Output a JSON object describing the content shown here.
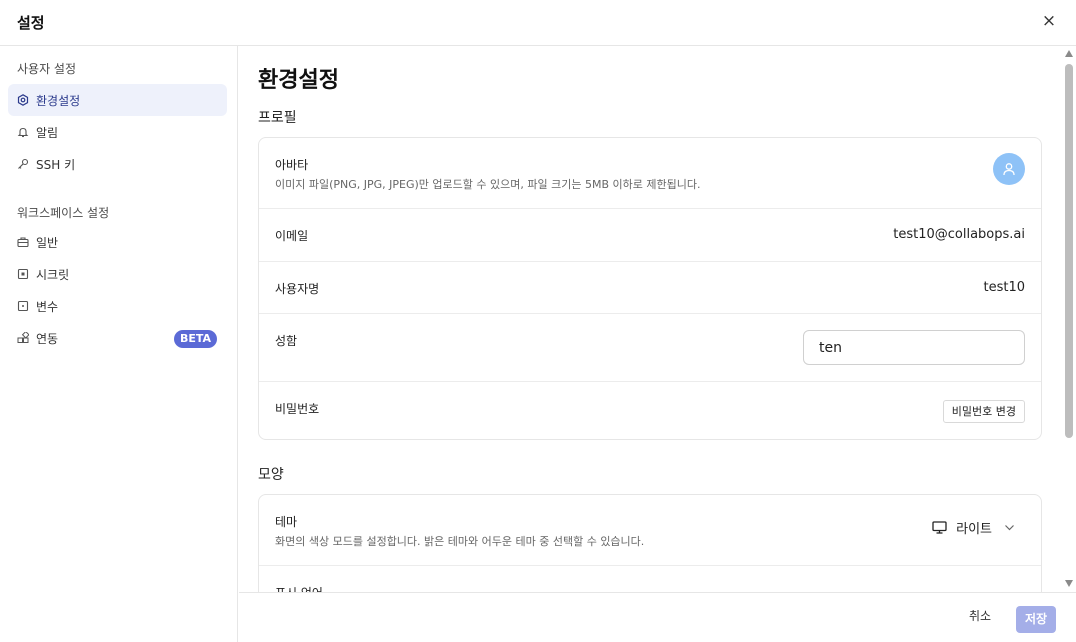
{
  "dialog": {
    "title": "설정",
    "close_label": "×"
  },
  "sidebar": {
    "user_section": "사용자 설정",
    "user_items": [
      {
        "label": "환경설정",
        "icon": "gear-icon",
        "active": true
      },
      {
        "label": "알림",
        "icon": "bell-icon"
      },
      {
        "label": "SSH 키",
        "icon": "key-icon"
      }
    ],
    "workspace_section": "워크스페이스 설정",
    "workspace_items": [
      {
        "label": "일반",
        "icon": "briefcase-icon"
      },
      {
        "label": "시크릿",
        "icon": "secret-icon"
      },
      {
        "label": "변수",
        "icon": "variable-icon"
      },
      {
        "label": "연동",
        "icon": "integration-icon",
        "badge": "BETA"
      }
    ]
  },
  "main": {
    "page_title": "환경설정",
    "profile": {
      "section_title": "프로필",
      "avatar_label": "아바타",
      "avatar_desc": "이미지 파일(PNG, JPG, JPEG)만 업로드할 수 있으며, 파일 크기는 5MB 이하로 제한됩니다.",
      "email_label": "이메일",
      "email_value": "test10@collabops.ai",
      "username_label": "사용자명",
      "username_value": "test10",
      "name_label": "성함",
      "name_value": "ten",
      "password_label": "비밀번호",
      "password_button": "비밀번호 변경"
    },
    "appearance": {
      "section_title": "모양",
      "theme_label": "테마",
      "theme_desc": "화면의 색상 모드를 설정합니다. 밝은 테마와 어두운 테마 중 선택할 수 있습니다.",
      "theme_value": "라이트",
      "language_label": "표시 언어"
    }
  },
  "footer": {
    "cancel_label": "취소",
    "save_label": "저장"
  },
  "colors": {
    "accent": "#5b6ad6",
    "active_bg": "#eef1fb",
    "save_bg": "#a4aee8",
    "avatar_bg": "#8ec2f7"
  }
}
